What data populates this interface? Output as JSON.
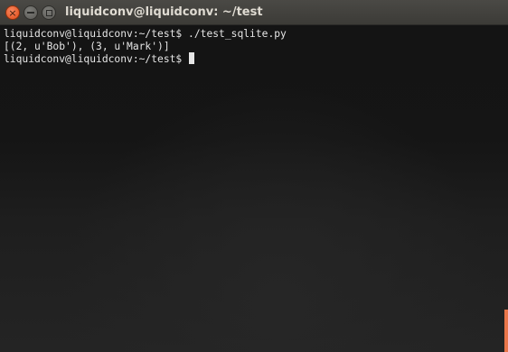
{
  "window": {
    "title": "liquidconv@liquidconv: ~/test",
    "buttons": {
      "close": "×",
      "minimize": "minimize-icon",
      "maximize": "maximize-icon"
    }
  },
  "terminal": {
    "lines": [
      "liquidconv@liquidconv:~/test$ ./test_sqlite.py",
      "[(2, u'Bob'), (3, u'Mark')]",
      "liquidconv@liquidconv:~/test$ "
    ]
  },
  "colors": {
    "close_button": "#df4a16",
    "text": "#e6e6e6",
    "accent": "#e9764a"
  }
}
